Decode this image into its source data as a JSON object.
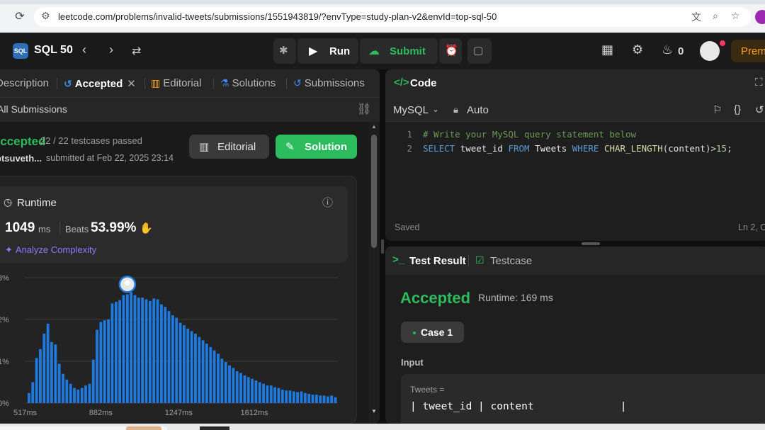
{
  "browser": {
    "url": "leetcode.com/problems/invalid-tweets/submissions/1551943819/?envType=study-plan-v2&envId=top-sql-50"
  },
  "topbar": {
    "logo_text": "SQL",
    "study_plan": "SQL 50",
    "run_label": "Run",
    "submit_label": "Submit",
    "streak_count": "0",
    "premium_label": "Prem"
  },
  "tabs": [
    {
      "label": "Description"
    },
    {
      "label": "Accepted"
    },
    {
      "label": "Editorial"
    },
    {
      "label": "Solutions"
    },
    {
      "label": "Submissions"
    }
  ],
  "left": {
    "all_submissions": "All Submissions",
    "status": "Accepted",
    "testcases": "22 / 22 testcases passed",
    "user": "otsuveth...",
    "submitted_at": "submitted at Feb 22, 2025 23:14",
    "editorial_btn": "Editorial",
    "solution_btn": "Solution",
    "runtime_label": "Runtime",
    "runtime_value": "1049",
    "runtime_unit": "ms",
    "beats_label": "Beats",
    "beats_value": "53.99%",
    "analyze_label": "Analyze Complexity"
  },
  "colors": {
    "accent_green": "#2cbb5d",
    "bar_blue": "#1f7ae0",
    "premium_orange": "#ffa116",
    "analyze_purple": "#8d7bff"
  },
  "chart_data": {
    "type": "bar",
    "title": "",
    "xlabel": "",
    "ylabel": "",
    "y_tick_labels": [
      "0%",
      "1%",
      "2%",
      "3%"
    ],
    "x_tick_labels": [
      "517ms",
      "882ms",
      "1247ms",
      "1612ms"
    ],
    "ylim": [
      0,
      3.2
    ],
    "grid": true,
    "values": [
      0.24,
      0.5,
      1.08,
      1.29,
      1.66,
      1.9,
      1.46,
      1.4,
      0.94,
      0.7,
      0.56,
      0.46,
      0.36,
      0.32,
      0.36,
      0.42,
      0.46,
      1.04,
      1.75,
      1.94,
      1.98,
      2.0,
      2.38,
      2.42,
      2.46,
      2.58,
      2.6,
      2.65,
      2.58,
      2.52,
      2.52,
      2.48,
      2.44,
      2.5,
      2.48,
      2.36,
      2.3,
      2.2,
      2.1,
      2.04,
      1.92,
      1.86,
      1.78,
      1.72,
      1.66,
      1.58,
      1.5,
      1.42,
      1.34,
      1.26,
      1.18,
      1.06,
      0.98,
      0.9,
      0.84,
      0.76,
      0.72,
      0.66,
      0.62,
      0.58,
      0.54,
      0.5,
      0.46,
      0.42,
      0.42,
      0.38,
      0.36,
      0.32,
      0.3,
      0.3,
      0.28,
      0.26,
      0.28,
      0.24,
      0.22,
      0.2,
      0.2,
      0.18,
      0.18,
      0.16,
      0.18,
      0.14
    ],
    "highlight_index": 26
  },
  "code": {
    "title": "Code",
    "language": "MySQL",
    "mode": "Auto",
    "lines": [
      {
        "n": "1",
        "text": "# Write your MySQL query statement below"
      },
      {
        "n": "2",
        "text": "SELECT tweet_id FROM Tweets WHERE CHAR_LENGTH(content)>15;"
      }
    ],
    "saved": "Saved",
    "cursor": "Ln 2, C"
  },
  "result": {
    "tab_result": "Test Result",
    "tab_testcase": "Testcase",
    "status": "Accepted",
    "runtime": "Runtime: 169 ms",
    "case_label": "Case 1",
    "input_label": "Input",
    "tweets_label": "Tweets =",
    "table_header": "| tweet_id | content              |"
  }
}
